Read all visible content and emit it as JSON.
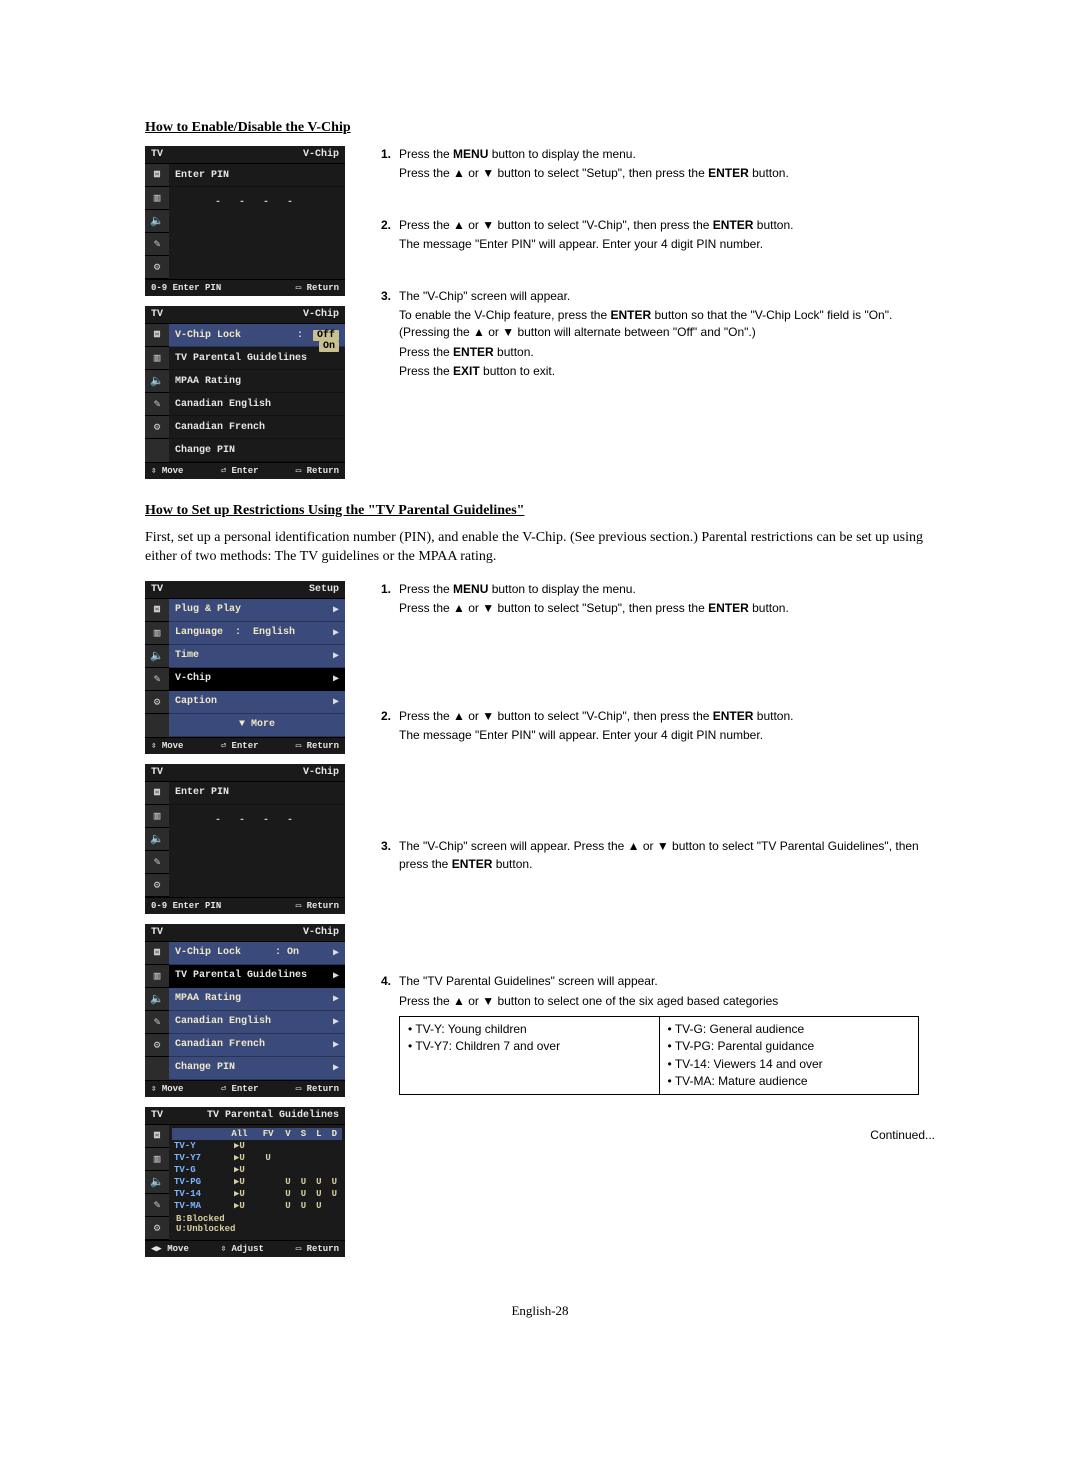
{
  "headings": {
    "section1": "How to Enable/Disable the V-Chip",
    "section2": "How to Set up Restrictions Using the \"TV Parental Guidelines\""
  },
  "intro_para": "First, set up a personal identification number (PIN), and enable the V-Chip. (See previous section.) Parental restrictions can be set up using either of two methods: The TV guidelines or the MPAA rating.",
  "steps_a": {
    "s1a": "Press the ",
    "s1b": "MENU",
    "s1c": " button to display the menu.",
    "s1d": "Press the ▲ or ▼ button to select \"Setup\", then press the ",
    "s1e": "ENTER",
    "s1f": " button.",
    "s2a": "Press the ▲ or ▼ button to select \"V-Chip\", then press the ",
    "s2b": "ENTER",
    "s2c": " button.",
    "s2d": "The message \"Enter PIN\" will appear. Enter your 4 digit PIN number.",
    "s3a": "The \"V-Chip\" screen will appear.",
    "s3b": "To enable the V-Chip feature, press the ",
    "s3c": "ENTER",
    "s3d": " button so that the \"V-Chip Lock\" field is \"On\". (Pressing the ▲ or ▼ button will alternate between \"Off\" and \"On\".)",
    "s3e": "Press the ",
    "s3f": "ENTER",
    "s3g": " button.",
    "s3h": "Press the ",
    "s3i": "EXIT",
    "s3j": " button to exit."
  },
  "steps_b": {
    "s1a": "Press the ",
    "s1b": "MENU",
    "s1c": " button to display the menu.",
    "s1d": "Press the ▲ or ▼ button to select \"Setup\", then press the ",
    "s1e": "ENTER",
    "s1f": " button.",
    "s2a": "Press the ▲ or ▼ button to select \"V-Chip\", then press the ",
    "s2b": "ENTER",
    "s2c": " button.",
    "s2d": "The message \"Enter PIN\" will appear. Enter your 4 digit PIN number.",
    "s3a": "The \"V-Chip\" screen will appear. Press the ▲ or ▼ button to select \"TV Parental Guidelines\", then press the ",
    "s3b": "ENTER",
    "s3c": " button.",
    "s4a": "The \"TV Parental Guidelines\" screen will appear.",
    "s4b": "Press the ▲ or ▼ button to select one of the six aged based categories"
  },
  "legend": {
    "l1": "• TV-Y: Young children",
    "l2": "• TV-Y7: Children 7 and over",
    "r1": "• TV-G:   General audience",
    "r2": "• TV-PG: Parental guidance",
    "r3": "• TV-14:  Viewers 14 and over",
    "r4": "• TV-MA: Mature audience"
  },
  "continued": "Continued...",
  "pagenum": "English-28",
  "osd": {
    "tv": "TV",
    "vchip": "V-Chip",
    "setup": "Setup",
    "tvpg_title": "TV Parental Guidelines",
    "enter_pin": "Enter PIN",
    "dashes": "- - - -",
    "return": "Return",
    "move": "Move",
    "enter": "Enter",
    "adjust": "Adjust",
    "prefix_09": "0-9",
    "icons": {
      "picture": "⧈",
      "channel": "▥",
      "sound": "🔈",
      "tools": "✎",
      "gear": "⚙"
    },
    "menu2": {
      "vchip_lock": "V-Chip Lock",
      "off": "Off",
      "on": "On",
      "tvpg": "TV Parental Guidelines",
      "mpaa": "MPAA Rating",
      "can_en": "Canadian English",
      "can_fr": "Canadian French",
      "change_pin": "Change PIN"
    },
    "menu3": {
      "plug": "Plug & Play",
      "lang": "Language",
      "lang_val": "English",
      "time": "Time",
      "vchip": "V-Chip",
      "caption": "Caption",
      "more": "More"
    },
    "grid": {
      "col_all": "All",
      "col_fv": "FV",
      "col_v": "V",
      "col_s": "S",
      "col_l": "L",
      "col_d": "D",
      "r_tvy": "TV-Y",
      "r_tvy7": "TV-Y7",
      "r_tvg": "TV-G",
      "r_tvpg": "TV-PG",
      "r_tv14": "TV-14",
      "r_tvma": "TV-MA",
      "u": "U",
      "legend_b": "B:Blocked",
      "legend_u": "U:Unblocked"
    }
  }
}
